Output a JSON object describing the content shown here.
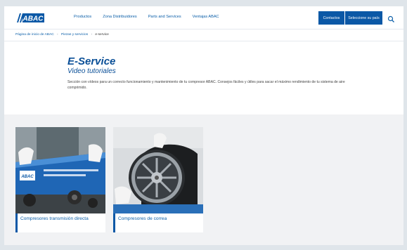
{
  "header": {
    "logo_text": "ABAC",
    "nav": [
      "Productos",
      "Zona Distribuidores",
      "Parts and Services",
      "Ventajas ABAC"
    ],
    "contact_label": "Contactos",
    "country_label": "Seleccione su país"
  },
  "breadcrumb": [
    "Página de inicio de ABAC",
    "Piezas y servicios",
    "e-service"
  ],
  "hero": {
    "title": "E-Service",
    "subtitle": "Video tutoriales",
    "description": "Sección con vídeos para un correcto funcionamiento y mantenimiento de tu compresor ABAC. Consejos fáciles y útiles para sacar el máximo rendimiento de tu sistema de aire comprimido."
  },
  "cards": [
    {
      "label": "Compresores transmisión directa"
    },
    {
      "label": "Compresores de correa"
    }
  ],
  "colors": {
    "brand_blue": "#0b58a6",
    "link_blue": "#0a5ea8",
    "title_blue": "#0a4f97"
  }
}
